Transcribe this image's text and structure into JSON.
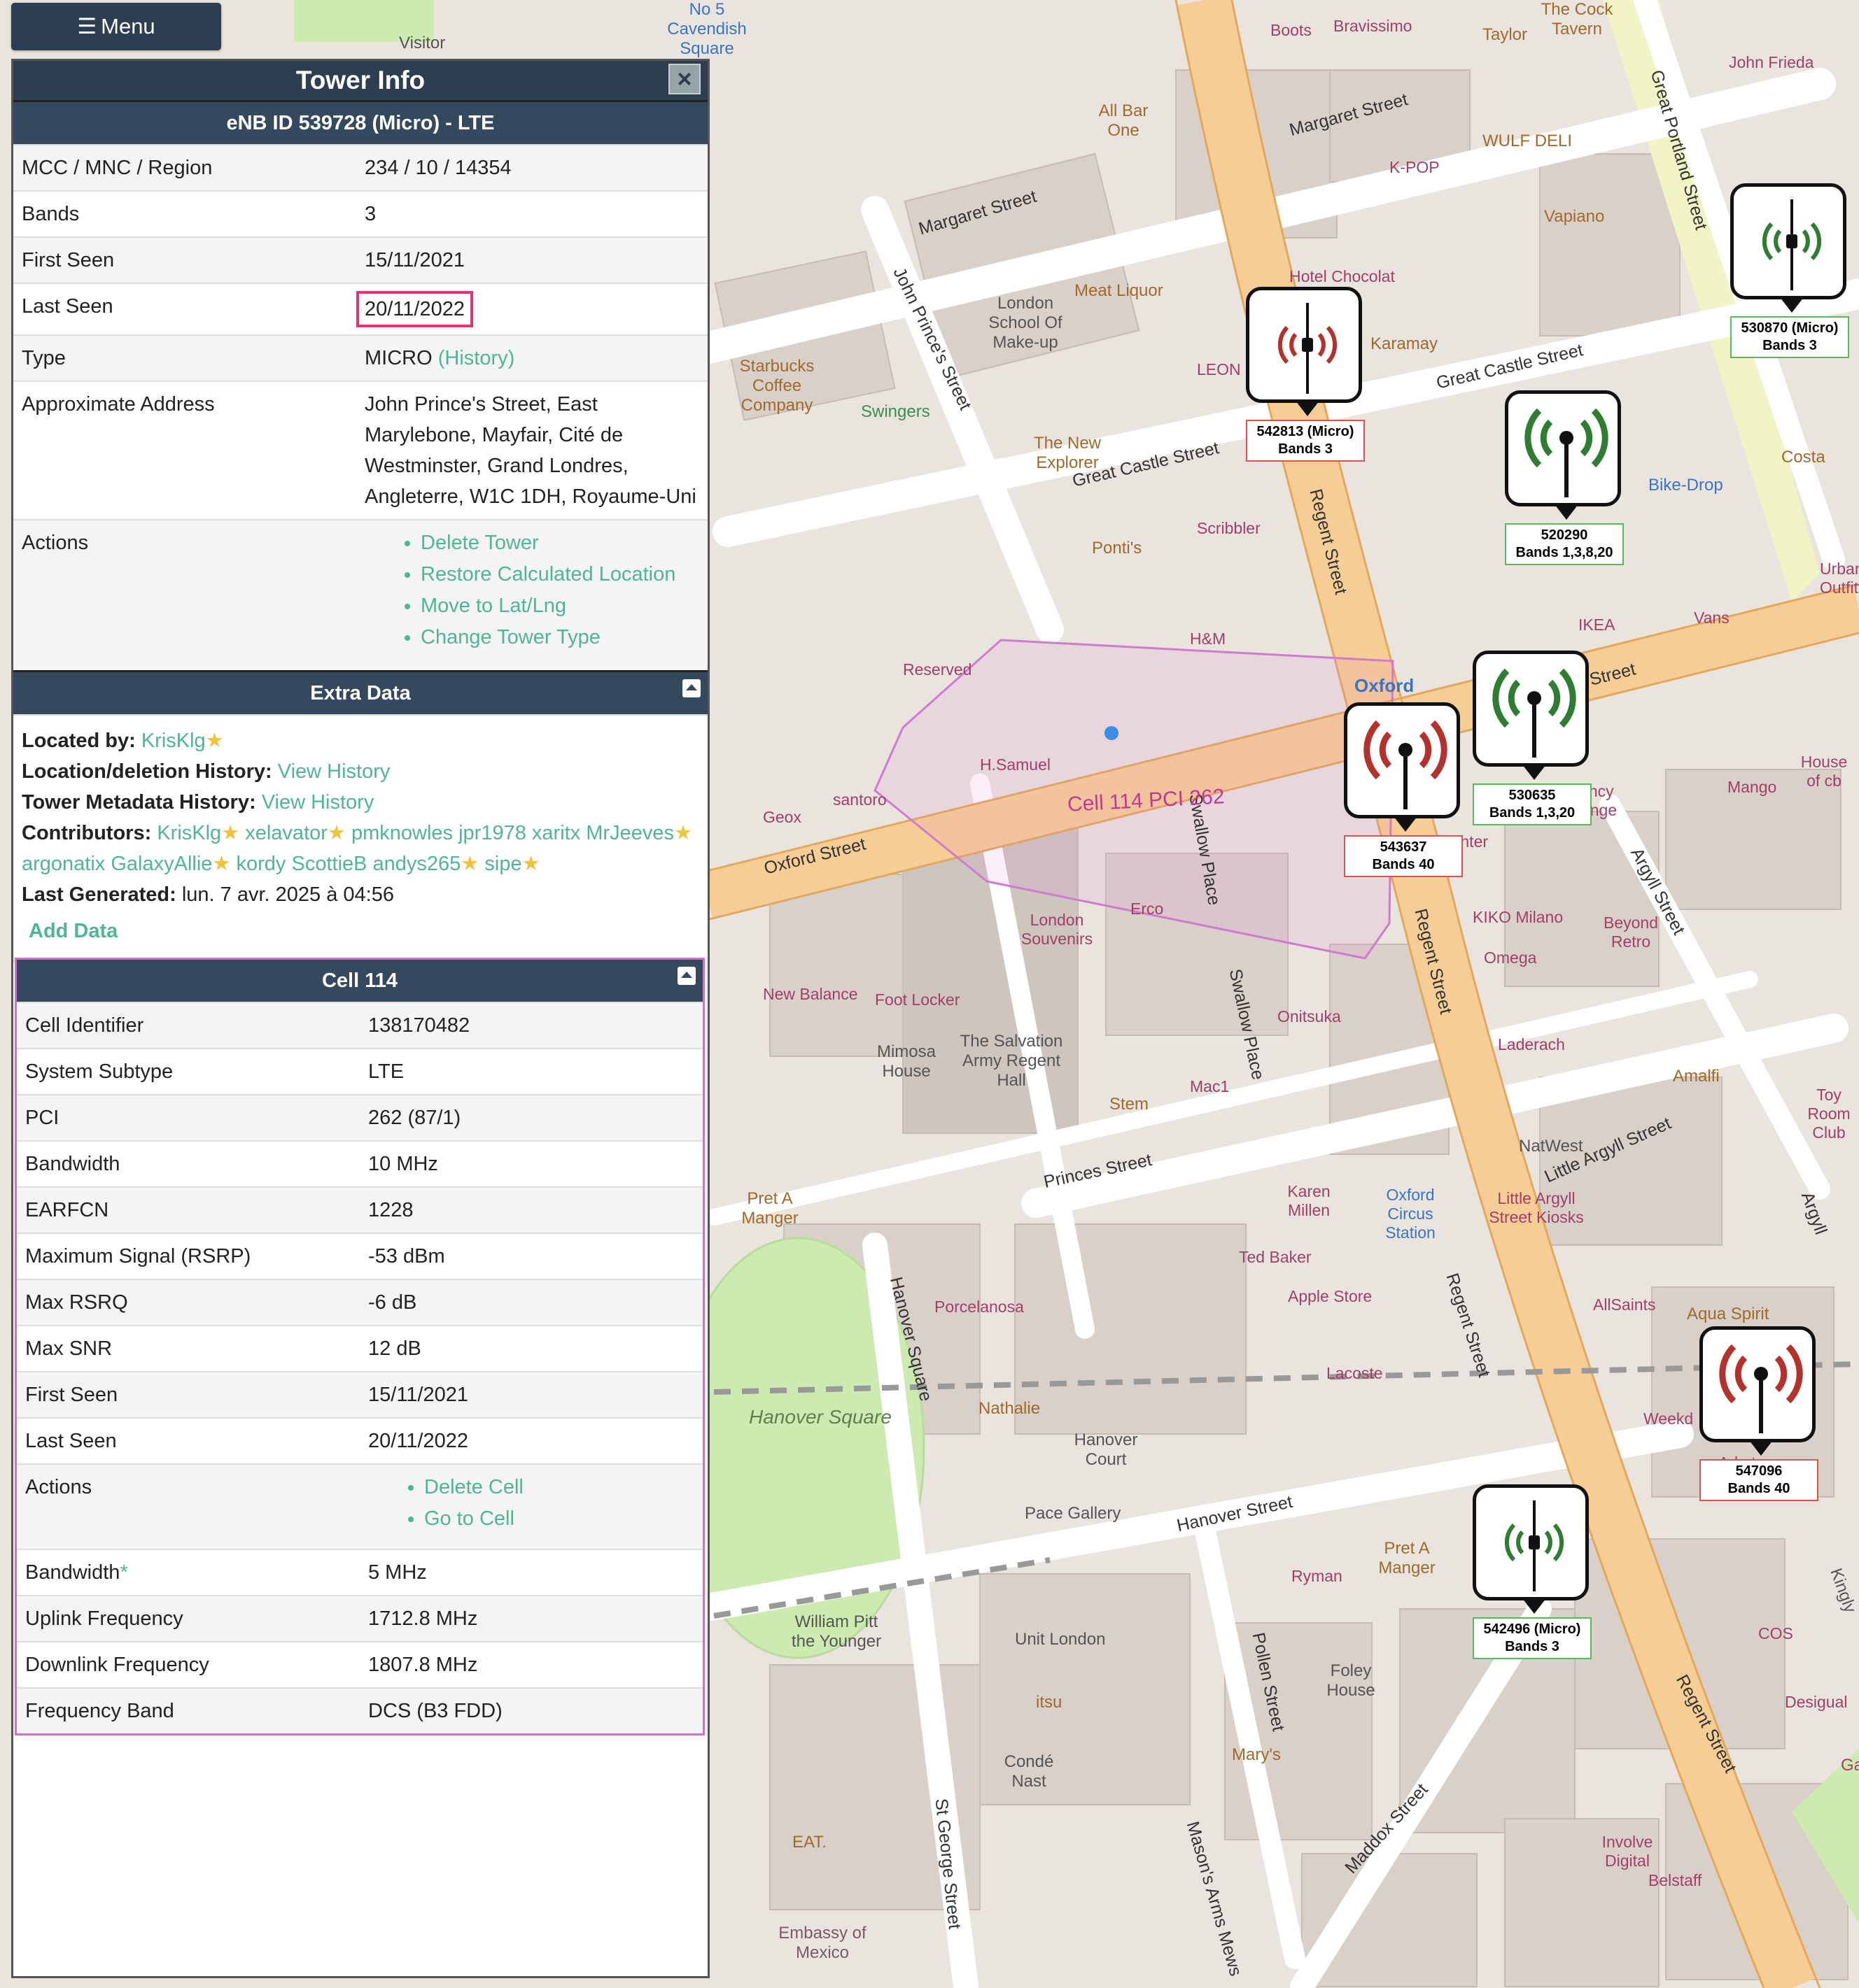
{
  "menu": {
    "label": "Menu"
  },
  "panel": {
    "title": "Tower Info",
    "close_label": "×",
    "tower_header": "eNB ID 539728 (Micro) - LTE",
    "tower_rows": [
      {
        "key": "MCC / MNC / Region",
        "value": "234 / 10 / 14354"
      },
      {
        "key": "Bands",
        "value": "3"
      },
      {
        "key": "First Seen",
        "value": "15/11/2021"
      },
      {
        "key": "Last Seen",
        "value": "20/11/2022"
      },
      {
        "key": "Type",
        "value": "MICRO",
        "link": "(History)"
      },
      {
        "key": "Approximate Address",
        "value": "John Prince's Street, East Marylebone, Mayfair, Cité de Westminster, Grand Londres, Angleterre, W1C 1DH, Royaume-Uni"
      },
      {
        "key": "Actions"
      }
    ],
    "tower_actions": [
      "Delete Tower",
      "Restore Calculated Location",
      "Move to Lat/Lng",
      "Change Tower Type"
    ],
    "extra": {
      "header": "Extra Data",
      "located_by_label": "Located by:",
      "located_by": "KrisKlg",
      "loc_history_label": "Location/deletion History:",
      "loc_history_link": "View History",
      "meta_history_label": "Tower Metadata History:",
      "meta_history_link": "View History",
      "contributors_label": "Contributors:",
      "contributors": [
        {
          "name": "KrisKlg",
          "star": true
        },
        {
          "name": "xelavator",
          "star": true
        },
        {
          "name": "pmknowles",
          "star": false
        },
        {
          "name": "jpr1978",
          "star": false
        },
        {
          "name": "xaritx",
          "star": false
        },
        {
          "name": "MrJeeves",
          "star": true
        },
        {
          "name": "argonatix",
          "star": false
        },
        {
          "name": "GalaxyAllie",
          "star": true
        },
        {
          "name": "kordy",
          "star": false
        },
        {
          "name": "ScottieB",
          "star": false
        },
        {
          "name": "andys265",
          "star": true
        },
        {
          "name": "sipe",
          "star": true
        }
      ],
      "generated_label": "Last Generated:",
      "generated": "lun. 7 avr. 2025 à 04:56",
      "add_data": "Add Data"
    },
    "cell": {
      "header": "Cell 114",
      "rows": [
        {
          "key": "Cell Identifier",
          "value": "138170482"
        },
        {
          "key": "System Subtype",
          "value": "LTE"
        },
        {
          "key": "PCI",
          "value": "262 (87/1)"
        },
        {
          "key": "Bandwidth",
          "value": "10 MHz"
        },
        {
          "key": "EARFCN",
          "value": "1228"
        },
        {
          "key": "Maximum Signal (RSRP)",
          "value": "-53 dBm"
        },
        {
          "key": "Max RSRQ",
          "value": "-6 dB"
        },
        {
          "key": "Max SNR",
          "value": "12 dB"
        },
        {
          "key": "First Seen",
          "value": "15/11/2021"
        },
        {
          "key": "Last Seen",
          "value": "20/11/2022"
        },
        {
          "key": "Actions"
        }
      ],
      "actions": [
        "Delete Cell",
        "Go to Cell"
      ],
      "rows2": [
        {
          "key": "Bandwidth",
          "value": "5 MHz",
          "asterisk": "*"
        },
        {
          "key": "Uplink Frequency",
          "value": "1712.8 MHz"
        },
        {
          "key": "Downlink Frequency",
          "value": "1807.8 MHz"
        },
        {
          "key": "Frequency Band",
          "value": "DCS (B3 FDD)"
        }
      ]
    }
  },
  "map": {
    "cell_label": "Cell 114 PCI 262",
    "markers": [
      {
        "id": "542813",
        "line1": "542813 (Micro)",
        "line2": "Bands 3",
        "color": "#b5312c",
        "kind": "micro"
      },
      {
        "id": "520290",
        "line1": "520290",
        "line2": "Bands 1,3,8,20",
        "color": "#2e7d32",
        "kind": "macro"
      },
      {
        "id": "530870",
        "line1": "530870 (Micro)",
        "line2": "Bands 3",
        "color": "#2e7d32",
        "kind": "micro"
      },
      {
        "id": "530635",
        "line1": "530635",
        "line2": "Bands 1,3,20",
        "color": "#2e7d32",
        "kind": "macro"
      },
      {
        "id": "543637",
        "line1": "543637",
        "line2": "Bands 40",
        "color": "#b5312c",
        "kind": "macro"
      },
      {
        "id": "547096",
        "line1": "547096",
        "line2": "Bands 40",
        "color": "#b5312c",
        "kind": "macro"
      },
      {
        "id": "542496",
        "line1": "542496 (Micro)",
        "line2": "Bands 3",
        "color": "#2e7d32",
        "kind": "micro"
      }
    ],
    "streets": [
      "Margaret Street",
      "Margaret Street",
      "Great Castle Street",
      "Great Castle Street",
      "Oxford Street",
      "Oxford Street",
      "Regent Street",
      "Regent Street",
      "Regent Street",
      "Regent Street",
      "Great Portland Street",
      "John Prince's Street",
      "Swallow Place",
      "Swallow Place",
      "Princes Street",
      "Hanover Square",
      "Hanover Street",
      "Little Argyll Street",
      "Argyll Street",
      "Pollen Street",
      "St George Street",
      "Maddox Street",
      "Mason's Arms Mews",
      "Argyll"
    ],
    "places": [
      "Hanover Square",
      "The Salvation Army Regent Hall",
      "London School Of Make-up",
      "Mimosa House",
      "Hanover Court",
      "Foley House",
      "Oxford Circus Station",
      "Little Argyll Street Kiosks",
      "Starbucks Coffee Company",
      "Swingers",
      "The New Explorer",
      "Scribbler",
      "Ponti's",
      "H&M",
      "Reserved",
      "H.Samuel",
      "santoro",
      "Geox",
      "London Souvenirs",
      "Erco",
      "New Balance",
      "Foot Locker",
      "Onitsuka",
      "Stem",
      "Mac1",
      "Karen Millen",
      "Ted Baker",
      "Apple Store",
      "Lacoste",
      "Nathalie",
      "Porcelanosa",
      "Pace Gallery",
      "Pret A Manger",
      "Pret A Manger",
      "Ryman",
      "Unit London",
      "itsu",
      "Condé Nast",
      "William Pitt the Younger",
      "EAT.",
      "Embassy of Mexico",
      "Mary's",
      "Involve Digital",
      "Belstaff",
      "COS",
      "Desigual",
      "AllSaints",
      "Aqua Spirit",
      "Arket",
      "Weekd",
      "Amalfi",
      "NatWest",
      "Laderach",
      "Omega",
      "KIKO Milano",
      "Beyond Retro",
      "Mango",
      "House of cb",
      "Toy Room Club",
      "Currency Exchange",
      "Inter",
      "IKEA",
      "Vans",
      "Bike-Drop",
      "Costa",
      "Karamay",
      "Hotel Chocolat",
      "Meat Liquor",
      "K-POP",
      "WULF DELI",
      "Vapiano",
      "Boots",
      "Bravissimo",
      "Taylor",
      "The Cock Tavern",
      "John Frieda",
      "All Bar One",
      "Visitor",
      "No 5 Cavendish Square",
      "Urban Outfitters",
      "LEON",
      "Kingly",
      "Ga",
      "Oxford"
    ]
  }
}
